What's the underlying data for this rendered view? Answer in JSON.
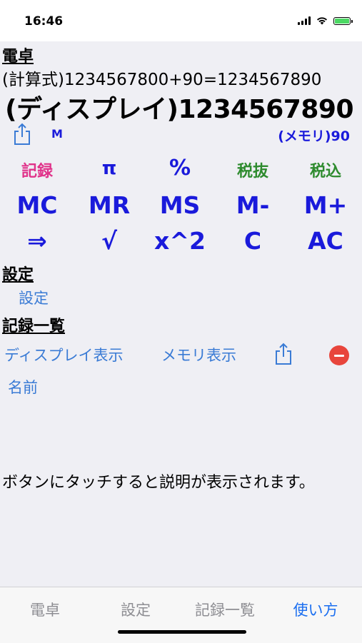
{
  "status": {
    "time": "16:46"
  },
  "calculator": {
    "header": "電卓",
    "formula": "(計算式)1234567800+90=1234567890",
    "display": "(ディスプレイ)1234567890",
    "memory_indicator": "M",
    "memory": "(メモリ)90",
    "keys_row1": [
      "記録",
      "π",
      "%",
      "税抜",
      "税込"
    ],
    "keys_row2": [
      "MC",
      "MR",
      "MS",
      "M-",
      "M+"
    ],
    "keys_row3": [
      "⇒",
      "√",
      "x^2",
      "C",
      "AC"
    ]
  },
  "settings": {
    "header": "設定",
    "link": "設定"
  },
  "records": {
    "header": "記録一覧",
    "display_show": "ディスプレイ表示",
    "memory_show": "メモリ表示",
    "name": "名前"
  },
  "help_text": "ボタンにタッチすると説明が表示されます。",
  "tabs": [
    "電卓",
    "設定",
    "記録一覧",
    "使い方"
  ],
  "colors": {
    "blue": "#1a1adb",
    "pink": "#e0338a",
    "green": "#2e8b2e",
    "link": "#3a7bd5",
    "active_tab": "#1a6ef0",
    "delete": "#e8453c"
  },
  "icons": [
    "share-icon",
    "minus-circle-icon",
    "signal-icon",
    "wifi-icon",
    "battery-icon"
  ]
}
